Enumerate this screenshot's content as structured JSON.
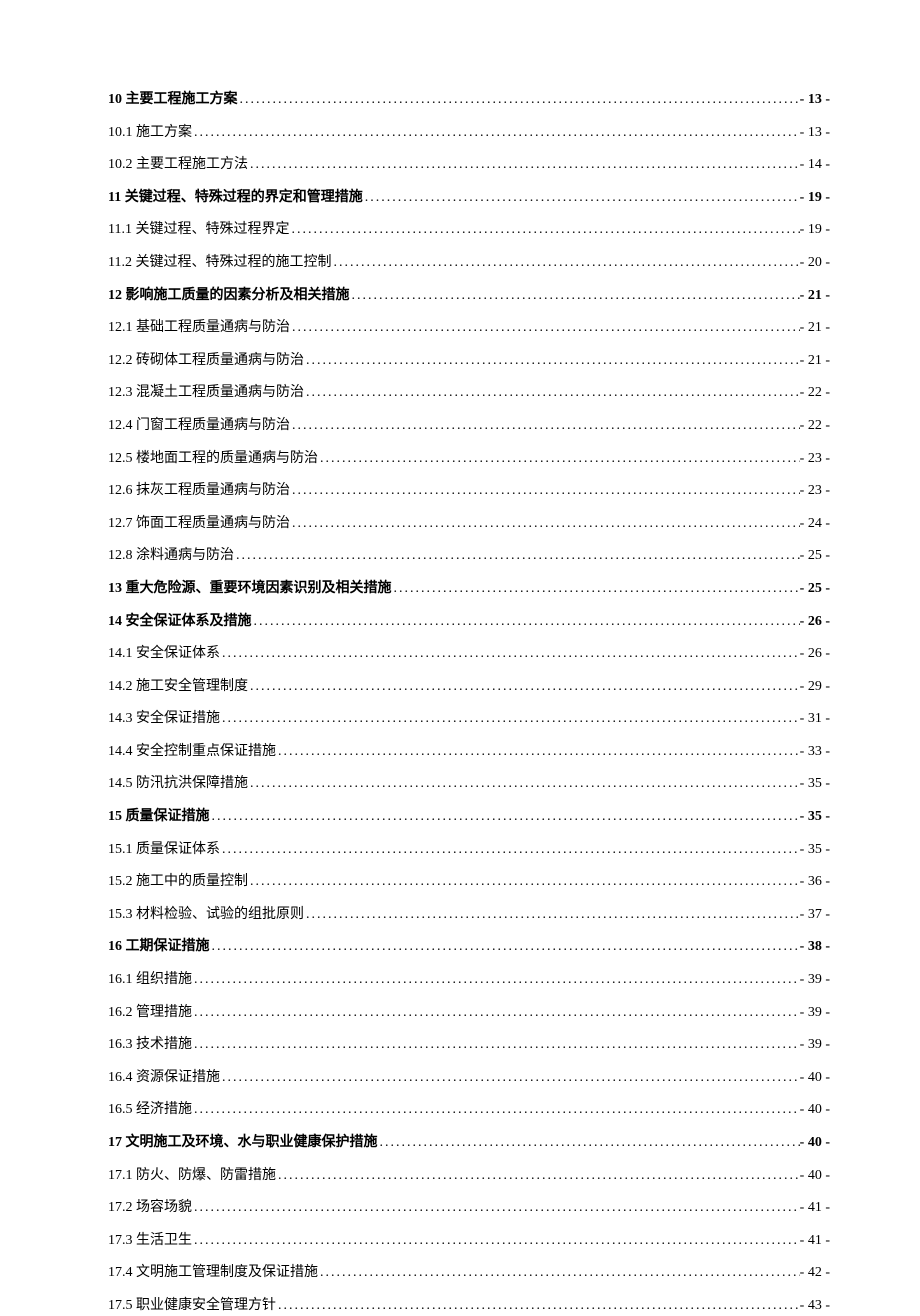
{
  "toc": [
    {
      "label": "10  主要工程施工方案",
      "page": "- 13 -",
      "bold": true
    },
    {
      "label": "10.1 施工方案",
      "page": "- 13 -",
      "bold": false
    },
    {
      "label": "10.2 主要工程施工方法",
      "page": "- 14 -",
      "bold": false
    },
    {
      "label": "11 关键过程、特殊过程的界定和管理措施",
      "page": "- 19 -",
      "bold": true
    },
    {
      "label": "11.1 关键过程、特殊过程界定",
      "page": "- 19 -",
      "bold": false
    },
    {
      "label": "11.2 关键过程、特殊过程的施工控制",
      "page": "- 20 -",
      "bold": false
    },
    {
      "label": "12 影响施工质量的因素分析及相关措施",
      "page": "- 21 -",
      "bold": true
    },
    {
      "label": "12.1 基础工程质量通病与防治",
      "page": "- 21 -",
      "bold": false
    },
    {
      "label": "12.2 砖砌体工程质量通病与防治",
      "page": "- 21 -",
      "bold": false
    },
    {
      "label": "12.3 混凝土工程质量通病与防治",
      "page": "- 22 -",
      "bold": false
    },
    {
      "label": "12.4 门窗工程质量通病与防治",
      "page": "- 22 -",
      "bold": false
    },
    {
      "label": "12.5 楼地面工程的质量通病与防治",
      "page": "- 23 -",
      "bold": false
    },
    {
      "label": "12.6 抹灰工程质量通病与防治",
      "page": "- 23 -",
      "bold": false
    },
    {
      "label": "12.7 饰面工程质量通病与防治",
      "page": "- 24 -",
      "bold": false
    },
    {
      "label": "12.8 涂料通病与防治",
      "page": "- 25 -",
      "bold": false
    },
    {
      "label": "13  重大危险源、重要环境因素识别及相关措施",
      "page": "- 25 -",
      "bold": true
    },
    {
      "label": "14  安全保证体系及措施",
      "page": "- 26 -",
      "bold": true
    },
    {
      "label": "14.1 安全保证体系",
      "page": "- 26 -",
      "bold": false
    },
    {
      "label": "14.2 施工安全管理制度",
      "page": "- 29 -",
      "bold": false
    },
    {
      "label": "14.3 安全保证措施",
      "page": "- 31 -",
      "bold": false
    },
    {
      "label": "14.4 安全控制重点保证措施",
      "page": "- 33 -",
      "bold": false
    },
    {
      "label": "14.5 防汛抗洪保障措施",
      "page": "- 35 -",
      "bold": false
    },
    {
      "label": "15  质量保证措施",
      "page": "- 35 -",
      "bold": true
    },
    {
      "label": "15.1 质量保证体系",
      "page": "- 35 -",
      "bold": false
    },
    {
      "label": "15.2 施工中的质量控制",
      "page": "- 36 -",
      "bold": false
    },
    {
      "label": "15.3 材料检验、试验的组批原则",
      "page": "- 37 -",
      "bold": false
    },
    {
      "label": "16  工期保证措施",
      "page": "- 38 -",
      "bold": true
    },
    {
      "label": "16.1 组织措施",
      "page": "- 39 -",
      "bold": false
    },
    {
      "label": "16.2 管理措施",
      "page": "- 39 -",
      "bold": false
    },
    {
      "label": "16.3 技术措施",
      "page": "- 39 -",
      "bold": false
    },
    {
      "label": "16.4 资源保证措施",
      "page": "- 40 -",
      "bold": false
    },
    {
      "label": "16.5 经济措施",
      "page": "- 40 -",
      "bold": false
    },
    {
      "label": "17  文明施工及环境、水与职业健康保护措施",
      "page": "- 40 -",
      "bold": true
    },
    {
      "label": "17.1 防火、防爆、防雷措施",
      "page": "- 40 -",
      "bold": false
    },
    {
      "label": "17.2 场容场貌",
      "page": "- 41 -",
      "bold": false
    },
    {
      "label": "17.3 生活卫生",
      "page": "- 41 -",
      "bold": false
    },
    {
      "label": "17.4 文明施工管理制度及保证措施",
      "page": "- 42 -",
      "bold": false
    },
    {
      "label": "17.5 职业健康安全管理方针",
      "page": "- 43 -",
      "bold": false
    }
  ]
}
